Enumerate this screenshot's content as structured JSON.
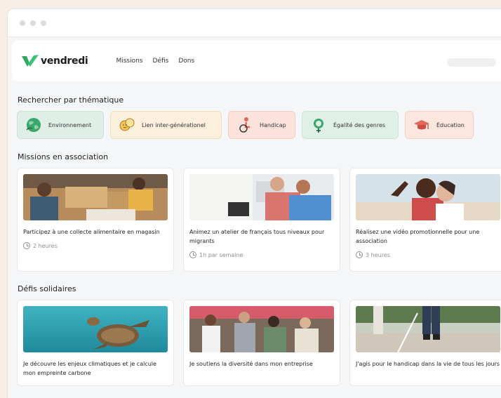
{
  "nav": {
    "brand": "vendredi",
    "links": [
      "Missions",
      "Défis",
      "Dons"
    ]
  },
  "thematics": {
    "title": "Rechercher par thématique",
    "chips": [
      {
        "label": "Environnement",
        "icon": "globe-icon"
      },
      {
        "label": "Lien inter-générationel",
        "icon": "faces-icon"
      },
      {
        "label": "Handicap",
        "icon": "wheelchair-icon"
      },
      {
        "label": "Égalité des genres",
        "icon": "gender-icon"
      },
      {
        "label": "Éducation",
        "icon": "graduation-cap-icon"
      }
    ]
  },
  "missions": {
    "title": "Missions en association",
    "items": [
      {
        "title": "Participez à une collecte alimentaire en magasin",
        "duration": "2 heures"
      },
      {
        "title": "Animez un atelier de français tous niveaux pour migrants",
        "duration": "1h par semaine"
      },
      {
        "title": "Réalisez une vidéo promotionnelle pour une association",
        "duration": "3 heures"
      }
    ]
  },
  "defis": {
    "title": "Défis solidaires",
    "items": [
      {
        "title": "Je découvre les enjeux climatiques et je calcule mon empreinte carbone"
      },
      {
        "title": "Je soutiens la diversité dans mon entreprise"
      },
      {
        "title": "J'agis pour le handicap dans la vie de tous les jours"
      }
    ]
  },
  "colors": {
    "brand_green": "#2fa865",
    "page_bg": "#f6eee6",
    "app_bg": "#f4f6f8"
  }
}
